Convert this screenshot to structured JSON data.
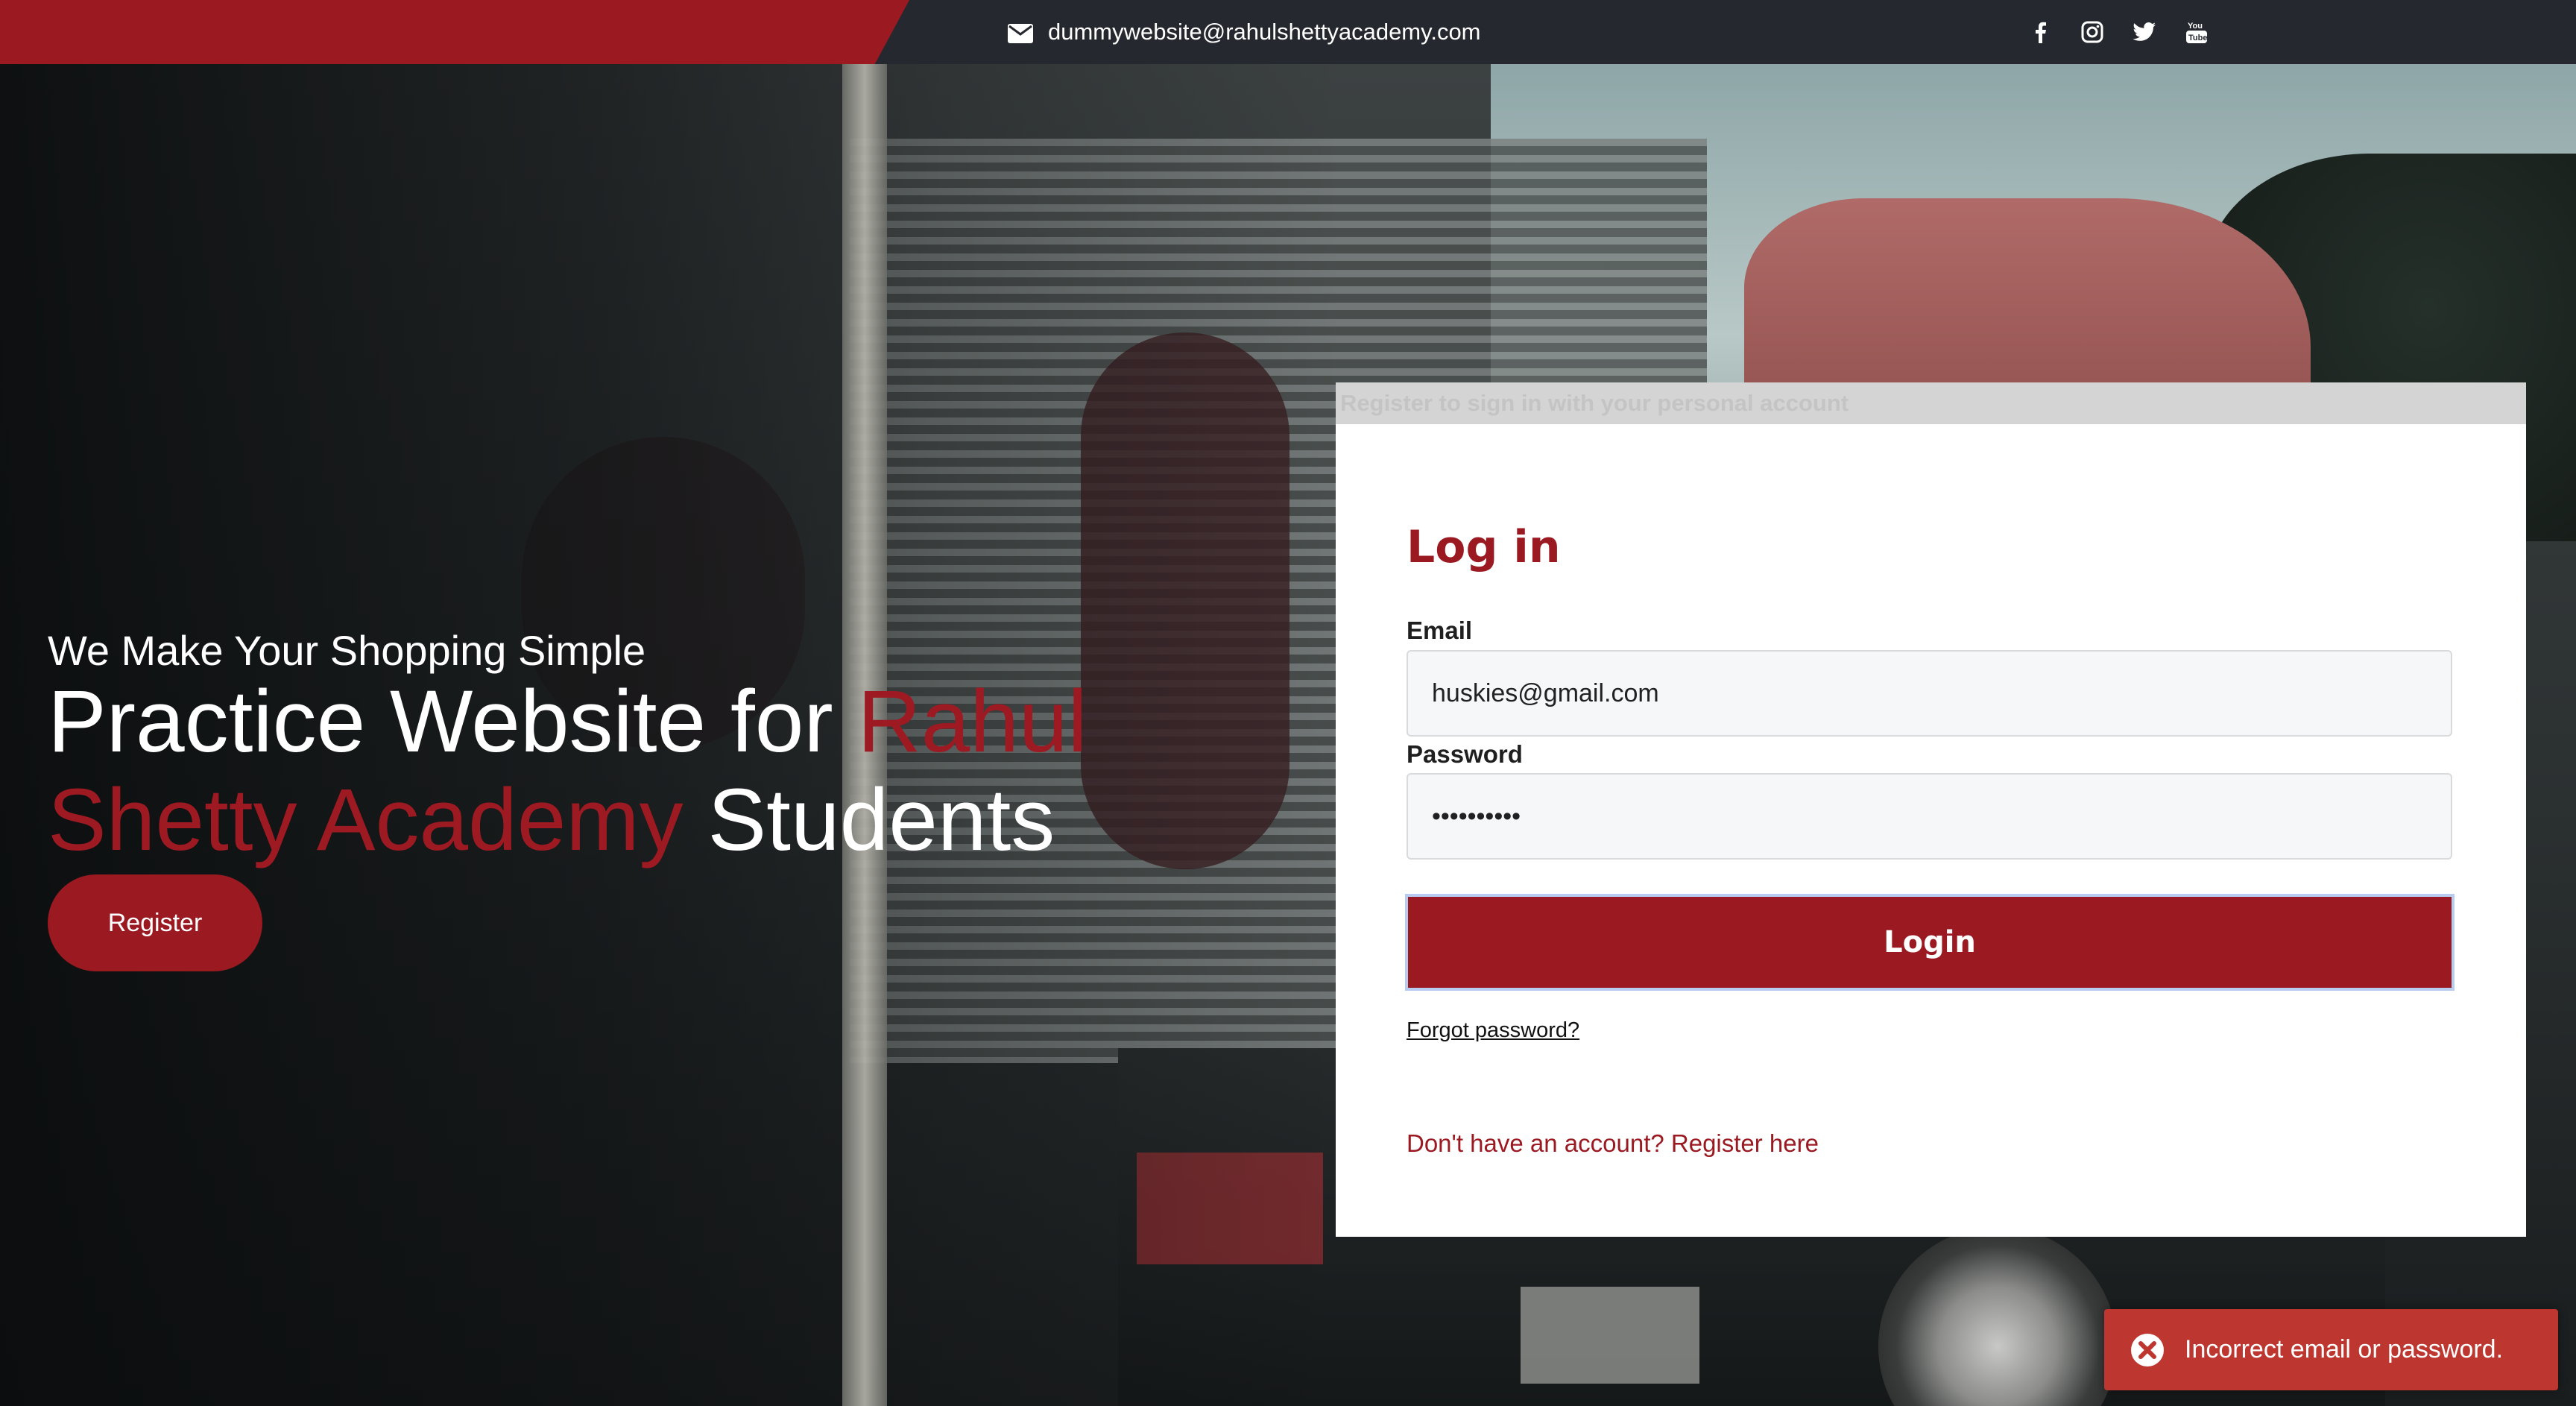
{
  "topbar": {
    "contact_email": "dummywebsite@rahulshettyacademy.com",
    "email_icon": "envelope-icon",
    "social_icons": [
      "facebook-icon",
      "instagram-icon",
      "twitter-icon",
      "youtube-icon"
    ],
    "accent_color": "#9b1a22",
    "background_color": "#25282e"
  },
  "hero": {
    "tagline": "We Make Your Shopping Simple",
    "headline_part1": "Practice Website for ",
    "headline_highlight": "Rahul Shetty Academy",
    "headline_part2": " Students",
    "register_button": "Register"
  },
  "login": {
    "header_text": "Register to sign in with your personal account",
    "title": "Log in",
    "email_label": "Email",
    "email_value": "huskies@gmail.com",
    "password_label": "Password",
    "password_value": "••••••••••",
    "login_button": "Login",
    "forgot_password": "Forgot password?",
    "register_link": "Don't have an account? Register here"
  },
  "toast": {
    "icon": "error-icon",
    "message": "Incorrect email or password.",
    "color": "#bd362f"
  }
}
